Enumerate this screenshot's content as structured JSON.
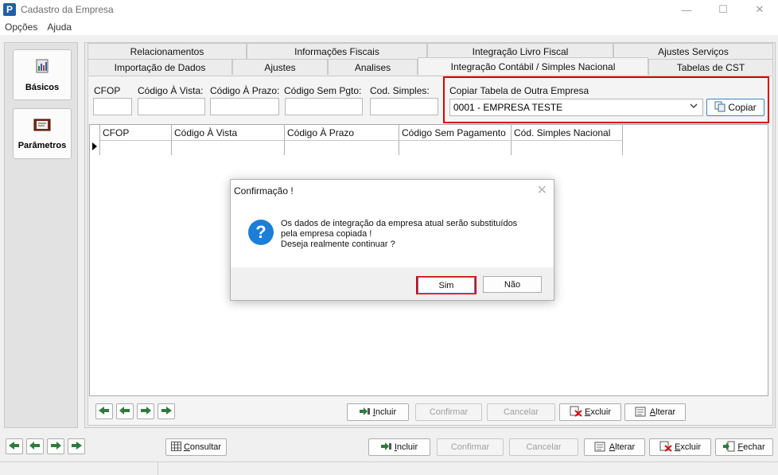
{
  "window": {
    "title": "Cadastro da Empresa",
    "app_icon_letter": "P"
  },
  "menu": [
    "Opções",
    "Ajuda"
  ],
  "sidebar": {
    "items": [
      {
        "label": "Básicos"
      },
      {
        "label": "Parâmetros"
      }
    ]
  },
  "tabs": {
    "row1": [
      "Relacionamentos",
      "Informações Fiscais",
      "Integração Livro Fiscal",
      "Ajustes Serviços"
    ],
    "row2": [
      "Importação de Dados",
      "Ajustes",
      "Analises",
      "Integração Contábil / Simples Nacional",
      "Tabelas de CST"
    ]
  },
  "form": {
    "labels": [
      "CFOP",
      "Código À Vista:",
      "Código À Prazo:",
      "Código Sem Pgto:",
      "Cod. Simples:"
    ],
    "values": [
      "",
      "",
      "",
      "",
      ""
    ],
    "copy_group_label": "Copiar Tabela de Outra Empresa",
    "company_select_value": "0001 - EMPRESA TESTE",
    "copy_button": "Copiar"
  },
  "grid": {
    "columns": [
      "CFOP",
      "Código À Vista",
      "Código À Prazo",
      "Código Sem Pagamento",
      "Cód. Simples Nacional"
    ]
  },
  "inner_toolbar": {
    "include": "Incluir",
    "confirm": "Confirmar",
    "cancel": "Cancelar",
    "delete": "Excluir",
    "edit": "Alterar"
  },
  "bottom_toolbar": {
    "consult": "Consultar",
    "include": "Incluir",
    "confirm": "Confirmar",
    "cancel": "Cancelar",
    "edit": "Alterar",
    "delete": "Excluir",
    "close": "Fechar"
  },
  "dialog": {
    "title": "Confirmação !",
    "message_lines": [
      "Os dados de integração da empresa atual serão substituídos",
      "pela empresa copiada !",
      "Deseja realmente continuar ?"
    ],
    "yes": "Sim",
    "no": "Não"
  },
  "colors": {
    "highlight": "#e00000",
    "accent": "#1c7ed6",
    "default_button_border": "#3d83c9"
  }
}
